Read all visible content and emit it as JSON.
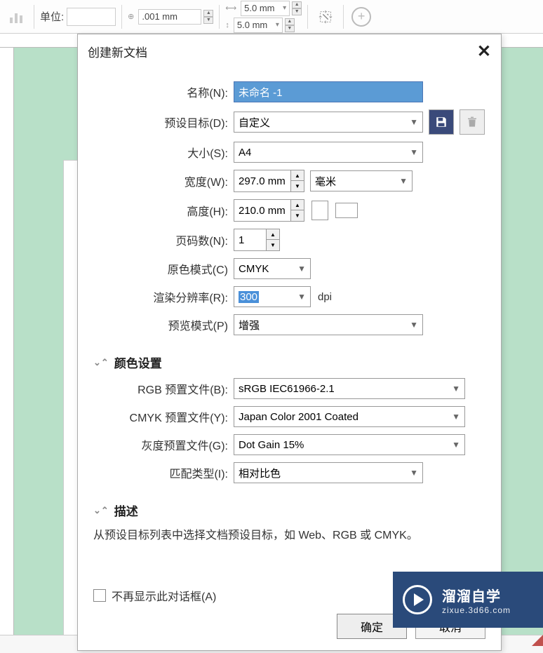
{
  "toolbar": {
    "unit_label": "单位:",
    "precision": ".001 mm",
    "dim_x": "5.0 mm",
    "dim_y": "5.0 mm"
  },
  "dialog": {
    "title": "创建新文档",
    "name_label": "名称(N):",
    "name_value": "未命名 -1",
    "preset_label": "预设目标(D):",
    "preset_value": "自定义",
    "size_label": "大小(S):",
    "size_value": "A4",
    "width_label": "宽度(W):",
    "width_value": "297.0 mm",
    "width_unit": "毫米",
    "height_label": "高度(H):",
    "height_value": "210.0 mm",
    "pages_label": "页码数(N):",
    "pages_value": "1",
    "colormode_label": "原色模式(C)",
    "colormode_value": "CMYK",
    "resolution_label": "渲染分辨率(R):",
    "resolution_value": "300",
    "resolution_unit": "dpi",
    "preview_label": "预览模式(P)",
    "preview_value": "增强",
    "section_color": "颜色设置",
    "rgb_label": "RGB 预置文件(B):",
    "rgb_value": "sRGB IEC61966-2.1",
    "cmyk_label": "CMYK 预置文件(Y):",
    "cmyk_value": "Japan Color 2001 Coated",
    "gray_label": "灰度预置文件(G):",
    "gray_value": "Dot Gain 15%",
    "intent_label": "匹配类型(I):",
    "intent_value": "相对比色",
    "section_desc": "描述",
    "desc_text": "从预设目标列表中选择文档预设目标，如 Web、RGB 或 CMYK。",
    "dont_show": "不再显示此对话框(A)",
    "ok": "确定",
    "cancel": "取消"
  },
  "badge": {
    "title": "溜溜自学",
    "sub": "zixue.3d66.com"
  }
}
